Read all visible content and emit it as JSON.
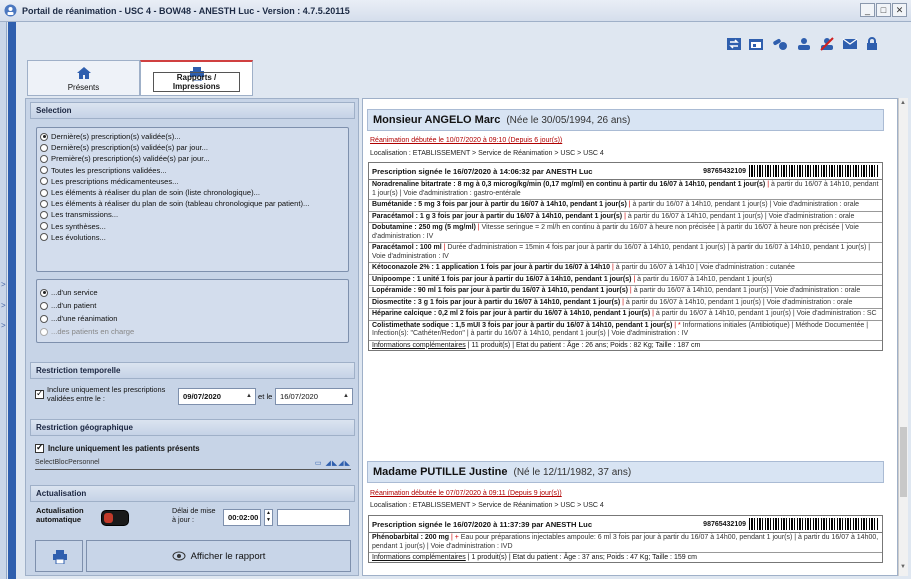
{
  "window": {
    "title": "Portail de réanimation - USC 4 - BOW48 - ANESTH Luc - Version : 4.7.5.20115",
    "buttons": [
      "_",
      "□",
      "✕"
    ]
  },
  "left_strip_arrows": [
    ">",
    ">",
    ">"
  ],
  "toolbar_icons": [
    "transfer-icon",
    "calendar-icon",
    "pills-icon",
    "user-group-icon",
    "user-doctor-icon",
    "mail-icon",
    "lock-icon"
  ],
  "tabs": [
    {
      "label": "Présents",
      "icon": "home-icon"
    },
    {
      "label": "Rapports / Impressions",
      "icon": "printer-icon"
    }
  ],
  "selection": {
    "title": "Selection",
    "options": [
      {
        "label": "Dernière(s) prescription(s) validée(s)...",
        "checked": true
      },
      {
        "label": "Dernière(s) prescription(s) validée(s) par jour...",
        "checked": false
      },
      {
        "label": "Première(s) prescription(s) validée(s) par jour...",
        "checked": false
      },
      {
        "label": "Toutes les prescriptions validées...",
        "checked": false
      },
      {
        "label": "Les prescriptions médicamenteuses...",
        "checked": false
      },
      {
        "label": "Les éléments à réaliser du plan de soin (liste chronologique)...",
        "checked": false
      },
      {
        "label": "Les éléments à réaliser du plan de soin (tableau chronologique par patient)...",
        "checked": false
      },
      {
        "label": "Les transmissions...",
        "checked": false
      },
      {
        "label": "Les synthèses...",
        "checked": false
      },
      {
        "label": "Les évolutions...",
        "checked": false
      }
    ],
    "scope": [
      {
        "label": "...d'un service",
        "checked": true,
        "disabled": false
      },
      {
        "label": "...d'un patient",
        "checked": false,
        "disabled": false
      },
      {
        "label": "...d'une réanimation",
        "checked": false,
        "disabled": false
      },
      {
        "label": "...des patients en charge",
        "checked": false,
        "disabled": true
      }
    ]
  },
  "temporal": {
    "title": "Restriction temporelle",
    "checkbox_label": "Inclure uniquement les prescriptions validées entre le :",
    "date_from": "09/07/2020",
    "and_label": "et le",
    "date_to": "16/07/2020"
  },
  "geo": {
    "title": "Restriction géographique",
    "checkbox_label": "Inclure uniquement les patients présents",
    "select_label": "SelectBlocPersonnel"
  },
  "actualisation": {
    "title": "Actualisation",
    "auto_label": "Actualisation automatique",
    "delay_label": "Délai de mise à jour :",
    "delay_value": "00:02:00"
  },
  "footer": {
    "show_report": "Afficher le rapport"
  },
  "patients": [
    {
      "name": "Monsieur ANGELO Marc",
      "born": "(Née le 30/05/1994, 26 ans)",
      "rea": "Réanimation débutée le 10/07/2020 à 09:10 (Depuis 6 jour(s))",
      "loc": "Localisation : ETABLISSEMENT > Service de Réanimation > USC > USC 4",
      "presc_head": "Prescription signée le 16/07/2020 à 14:06:32 par ANESTH Luc",
      "code": "98765432109",
      "meds": [
        {
          "bold": "Noradrenaline bitartrate : 8 mg à 0,3 microg/kg/min (0,17 mg/ml) en continu à partir du 16/07 à 14h10, pendant 1 jour(s)",
          "sep": " | ",
          "rest": "à partir du 16/07 à 14h10, pendant 1 jour(s) | Voie d'administration : gastro-entérale"
        },
        {
          "bold": "Bumétanide : 5 mg 3 fois par jour à partir du 16/07 à 14h10, pendant 1 jour(s)",
          "sep": " | ",
          "rest": "à partir du 16/07 à 14h10, pendant 1 jour(s) | Voie d'administration : orale"
        },
        {
          "bold": "Paracétamol : 1 g 3 fois par jour à partir du 16/07 à 14h10, pendant 1 jour(s)",
          "sep": " | ",
          "rest": "à partir du 16/07 à 14h10, pendant 1 jour(s) | Voie d'administration : orale"
        },
        {
          "bold": "Dobutamine : 250 mg (5 mg/ml)",
          "sep": " | ",
          "rest": "Vitesse seringue = 2 ml/h en continu à partir du 16/07 à heure non précisée | à partir du 16/07 à heure non précisée | Voie d'administration : IV"
        },
        {
          "bold": "Paracétamol : 100 ml",
          "sep": " | ",
          "rest": "Durée d'administration = 15min 4 fois par jour à partir du 16/07 à 14h10, pendant 1 jour(s) | à partir du 16/07 à 14h10, pendant 1 jour(s) | Voie d'administration : IV"
        },
        {
          "bold": "Kétoconazole 2% : 1 application 1 fois par jour à partir du 16/07 à 14h10",
          "sep": " | ",
          "rest": "à partir du 16/07 à 14h10 | Voie d'administration : cutanée"
        },
        {
          "bold": "Unipoompe : 1 unité 1 fois par jour à partir du 16/07 à 14h10, pendant 1 jour(s)",
          "sep": " | ",
          "rest": "à partir du 16/07 à 14h10, pendant 1 jour(s)"
        },
        {
          "bold": "Lopéramide : 90 ml 1 fois par jour à partir du 16/07 à 14h10, pendant 1 jour(s)",
          "sep": " | ",
          "rest": "à partir du 16/07 à 14h10, pendant 1 jour(s) | Voie d'administration : orale"
        },
        {
          "bold": "Diosmectite : 3 g 1 fois par jour à partir du 16/07 à 14h10, pendant 1 jour(s)",
          "sep": " | ",
          "rest": "à partir du 16/07 à 14h10, pendant 1 jour(s) | Voie d'administration : orale"
        },
        {
          "bold": "Héparine calcique : 0,2 ml 2 fois par jour à partir du 16/07 à 14h10, pendant 1 jour(s)",
          "sep": " | ",
          "rest": "à partir du 16/07 à 14h10, pendant 1 jour(s) | Voie d'administration : SC"
        },
        {
          "bold": "Colistimethate sodique : 1,5 mUI 3 fois par jour à partir du 16/07 à 14h10, pendant 1 jour(s)",
          "sep": " | * ",
          "rest": "Informations initiales (Antibiotique) | Méthode Documentée | Infection(s): \"Cathéter/Redon\" | à partir du 16/07 à 14h10, pendant 1 jour(s) | Voie d'administration : IV"
        }
      ],
      "info_link": "Informations complémentaires",
      "info_rest": " | 11 produit(s) | Etat du patient : Âge : 26 ans; Poids : 82 Kg; Taille : 187 cm"
    },
    {
      "name": "Madame PUTILLE Justine",
      "born": "(Né le 12/11/1982, 37 ans)",
      "rea": "Réanimation débutée le 07/07/2020 à 09:11 (Depuis 9 jour(s))",
      "loc": "Localisation : ETABLISSEMENT > Service de Réanimation > USC > USC 4",
      "presc_head": "Prescription signée le 16/07/2020 à 11:37:39 par ANESTH Luc",
      "code": "98765432109",
      "meds": [
        {
          "bold": "Phénobarbital : 200 mg",
          "sep": " | + ",
          "rest": "Eau pour préparations injectables ampoule: 6 ml 3 fois par jour à partir du 16/07 à 14h00, pendant 1 jour(s) | à partir du 16/07 à 14h00, pendant 1 jour(s) | Voie d'administration : IVD"
        }
      ],
      "info_link": "Informations complémentaires",
      "info_rest": " | 1 produit(s) | Etat du patient : Âge : 37 ans; Poids : 47 Kg; Taille : 159 cm"
    }
  ],
  "colors": {
    "accent_blue": "#2f5fae",
    "red_text": "#b00000",
    "panel_bg": "#c7d4e7"
  }
}
